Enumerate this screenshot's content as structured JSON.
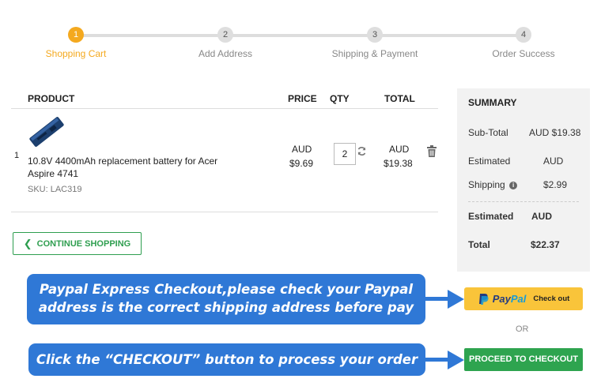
{
  "steps": [
    {
      "number": "1",
      "label": "Shopping Cart",
      "active": true
    },
    {
      "number": "2",
      "label": "Add Address",
      "active": false
    },
    {
      "number": "3",
      "label": "Shipping & Payment",
      "active": false
    },
    {
      "number": "4",
      "label": "Order Success",
      "active": false
    }
  ],
  "cart": {
    "headers": {
      "product": "PRODUCT",
      "price": "PRICE",
      "qty": "QTY",
      "total": "TOTAL"
    },
    "items": [
      {
        "index": "1",
        "name": "10.8V 4400mAh replacement battery for Acer Aspire 4741",
        "sku": "SKU: LAC319",
        "price_currency": "AUD",
        "price_value": "$9.69",
        "qty": "2",
        "total_currency": "AUD",
        "total_value": "$19.38",
        "image_icon": "laptop-battery-image",
        "refresh_icon": "refresh-icon",
        "delete_icon": "trash-icon"
      }
    ],
    "continue_label": "CONTINUE SHOPPING"
  },
  "summary": {
    "title": "SUMMARY",
    "subtotal_label": "Sub-Total",
    "subtotal_value": "AUD $19.38",
    "estimated_label": "Estimated",
    "estimated_value": "AUD",
    "shipping_label": "Shipping",
    "shipping_value": "$2.99",
    "estimated_total_label": "Estimated",
    "estimated_total_value": "AUD",
    "total_label": "Total",
    "total_value": "$22.37"
  },
  "callouts": {
    "paypal_line1": "Paypal Express Checkout,please check your Paypal",
    "paypal_line2": "address is the correct shipping address before pay",
    "checkout": "Click the “CHECKOUT” button to process your order"
  },
  "paypal": {
    "pay": "Pay",
    "pal": "Pal",
    "checkout_label": "Check out"
  },
  "or_label": "OR",
  "checkout_label": "PROCEED TO CHECKOUT",
  "colors": {
    "accent_orange": "#f4a91f",
    "green": "#2ea44f",
    "callout_blue": "#2f78d6",
    "paypal_yellow": "#f9c43a",
    "summary_bg": "#f2f2f2"
  }
}
